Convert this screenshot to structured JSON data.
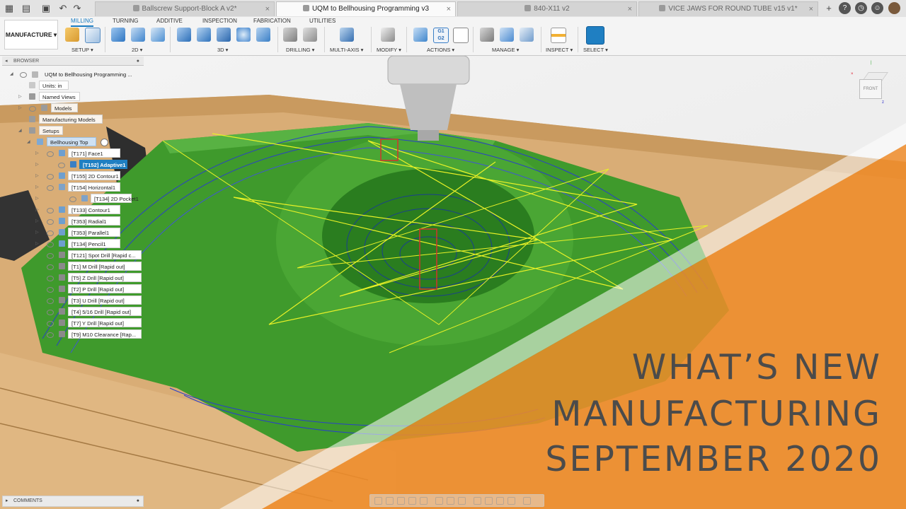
{
  "tabs": [
    {
      "label": "Ballscrew Support-Block A v2*",
      "active": false
    },
    {
      "label": "UQM to Bellhousing Programming v3",
      "active": true
    },
    {
      "label": "840-X11 v2",
      "active": false
    },
    {
      "label": "VICE JAWS FOR ROUND TUBE v15 v1*",
      "active": false
    }
  ],
  "toolbar_icons": [
    "grid-icon",
    "file-icon",
    "save-icon",
    "undo-icon",
    "redo-icon"
  ],
  "user_icons": [
    "help-icon",
    "notification-icon",
    "account-icon"
  ],
  "workspace_label": "MANUFACTURE",
  "ribbon_tabs": [
    "MILLING",
    "TURNING",
    "ADDITIVE",
    "INSPECTION",
    "FABRICATION",
    "UTILITIES"
  ],
  "active_ribbon_tab": "MILLING",
  "ribbon_groups": [
    "SETUP",
    "2D",
    "3D",
    "DRILLING",
    "MULTI-AXIS",
    "MODIFY",
    "ACTIONS",
    "MANAGE",
    "INSPECT",
    "SELECT"
  ],
  "browser": {
    "title": "BROWSER",
    "document": "UQM to Bellhousing Programming ...",
    "units": "Units: in",
    "named_views": "Named Views",
    "models": "Models",
    "manufacturing_models": "Manufacturing Models",
    "setups": "Setups",
    "setup_name": "Bellhousing Top",
    "operations": [
      "[T171] Face1",
      "[T152] Adaptive1",
      "[T155] 2D Contour1",
      "[T154] Horizontal1",
      "[T134] 2D Pocket1",
      "[T133] Contour1",
      "[T353] Radial1",
      "[T353] Parallel1",
      "[T134] Pencil1",
      "[T121] Spot Drill [Rapid c...",
      "[T1] M Drill [Rapid out]",
      "[T5] Z Drill [Rapid out]",
      "[T2] P Drill [Rapid out]",
      "[T3] U Drill [Rapid out]",
      "[T4] 5/16 Drill [Rapid out]",
      "[T7] Y Drill [Rapid out]",
      "[T9] M10 Clearance [Rap..."
    ],
    "selected_index": 1
  },
  "comments_label": "COMMENTS",
  "viewcube_label": "FRONT",
  "headline": [
    "WHAT’S NEW",
    "MANUFACTURING",
    "SEPTEMBER 2020"
  ],
  "colors": {
    "accent": "#1f7fc2",
    "overlay_orange": "#ef8c2a",
    "part_green": "#3f9a2c",
    "stock_tan": "#d8aa72",
    "toolpath_yellow": "#e9f227",
    "toolpath_blue": "#2a3fc9"
  }
}
